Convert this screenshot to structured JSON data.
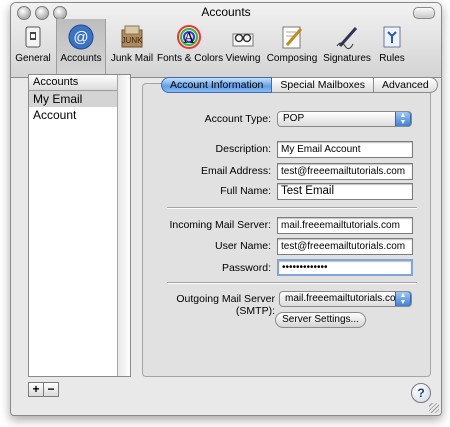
{
  "window": {
    "title": "Accounts"
  },
  "toolbar": {
    "items": [
      {
        "label": "General",
        "icon": "switch-icon",
        "selected": false
      },
      {
        "label": "Accounts",
        "icon": "at-sign-icon",
        "selected": true
      },
      {
        "label": "Junk Mail",
        "icon": "junk-mail-icon",
        "selected": false
      },
      {
        "label": "Fonts & Colors",
        "icon": "fonts-colors-icon",
        "selected": false
      },
      {
        "label": "Viewing",
        "icon": "glasses-icon",
        "selected": false
      },
      {
        "label": "Composing",
        "icon": "pencil-paper-icon",
        "selected": false
      },
      {
        "label": "Signatures",
        "icon": "signature-pen-icon",
        "selected": false
      },
      {
        "label": "Rules",
        "icon": "rules-icon",
        "selected": false
      }
    ]
  },
  "accounts": {
    "header": "Accounts",
    "items": [
      "My Email Account"
    ],
    "add_label": "+",
    "remove_label": "−"
  },
  "tabs": {
    "items": [
      "Account Information",
      "Special Mailboxes",
      "Advanced"
    ],
    "active": "Account Information"
  },
  "form": {
    "account_type_label": "Account Type:",
    "account_type_value": "POP",
    "description_label": "Description:",
    "description_value": "My Email Account",
    "email_label": "Email Address:",
    "email_value": "test@freeemailtutorials.com",
    "fullname_label": "Full Name:",
    "fullname_value": "Test Email",
    "incoming_label": "Incoming Mail Server:",
    "incoming_value": "mail.freeemailtutorials.com",
    "username_label": "User Name:",
    "username_value": "test@freeemailtutorials.com",
    "password_label": "Password:",
    "password_value": "•••••••••••••",
    "smtp_label": "Outgoing Mail Server (SMTP):",
    "smtp_value": "mail.freeemailtutorials.con",
    "server_settings_label": "Server Settings..."
  },
  "help_label": "?",
  "colors": {
    "accent": "#5f9ee9",
    "window_bg": "#e9e9e9"
  }
}
